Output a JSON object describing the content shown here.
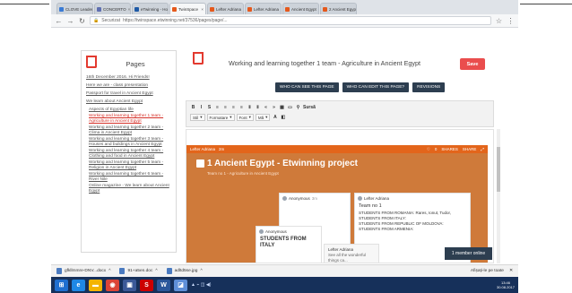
{
  "browser": {
    "tabs": [
      {
        "label": "CLOVE Leader",
        "color": "#3a7bd5"
      },
      {
        "label": "CONCERTO",
        "color": "#5f6fb0"
      },
      {
        "label": "eTwinning - Ho",
        "color": "#1f5aa6"
      },
      {
        "label": "TwinSpace",
        "color": "#e5591c"
      },
      {
        "label": "Lefter Adriana",
        "color": "#e5591c"
      },
      {
        "label": "Lefter Adriana",
        "color": "#e5591c"
      },
      {
        "label": "Ancient Egypt",
        "color": "#e5591c"
      },
      {
        "label": "2 Ancient Egypt",
        "color": "#e5591c"
      }
    ],
    "url_prefix": "Securizat",
    "url": "https://twinspace.etwinning.net/37536/pages/page/..."
  },
  "sidebar": {
    "title": "Pages",
    "items": [
      {
        "label": "16th December 2016. Hi Friends!",
        "cls": ""
      },
      {
        "label": "Here we are - class presentation",
        "cls": ""
      },
      {
        "label": "Passport for travel in Ancient Egypt",
        "cls": ""
      },
      {
        "label": "We learn about Ancient Egypt",
        "cls": "gap"
      },
      {
        "label": "Aspects of Egyptian life",
        "cls": "sub"
      },
      {
        "label": "Working and learning together 1 team - Agriculture in Ancient Egypt",
        "cls": "sub cur"
      },
      {
        "label": "Working and learning together 2 team - Clima in Ancient Egypt",
        "cls": "sub"
      },
      {
        "label": "Working and learning together 3 team - Houses and buildings in Ancient Egypt",
        "cls": "sub"
      },
      {
        "label": "Working and learning together 4 team - Clothing and food in Ancient Egypt",
        "cls": "sub"
      },
      {
        "label": "Working and learning together 5 team - Religion in Ancient Egypt",
        "cls": "sub"
      },
      {
        "label": "Working and learning together 6 team - River Nile",
        "cls": "sub"
      },
      {
        "label": "Online magazine - We learn about Ancient Egypt",
        "cls": "sub"
      }
    ]
  },
  "page": {
    "title": "Working and learning together 1 team - Agriculture in Ancient Egypt",
    "save_label": "Save",
    "actions": [
      "WHO CAN SEE THIS PAGE",
      "WHO CAN EDIT THIS PAGE?",
      "REVISIONS"
    ]
  },
  "editor": {
    "row1": [
      "B",
      "I",
      "S",
      "≡",
      "≡",
      "≡",
      "≡",
      "Ⅱ",
      "Ⅱ",
      "«",
      "»",
      "▦",
      "▭",
      "⚲",
      "Sursă"
    ],
    "row2": {
      "style": "Stil",
      "format": "Formatare",
      "font": "Font",
      "size": "Mă"
    }
  },
  "embed": {
    "author": "Lefter Adriana",
    "time": "2m",
    "bar_right": [
      "0",
      "SHARES",
      "SHARE"
    ],
    "title": "1 Ancient Egypt - Etwinning project",
    "subtitle": "Team no 1 - Agriculture in Ancient Egypt",
    "card1_author": "Anonymous",
    "card1_time": "3m",
    "card2_author": "Lefter Adriana",
    "card2_heading": "Team no 1",
    "card2_lines": [
      "STUDENTS FROM ROMANIA: Rares, Ionut, Tudor,",
      "STUDENTS FROM ITALY:",
      "STUDENTS FROM REPUBLIC OF MOLDOVA:",
      "STUDENTS FROM ARMENIA:"
    ],
    "card3_author": "Anonymous",
    "card3_text": "STUDENTS FROM ITALY",
    "card4_author": "Lefter Adriana",
    "card4_text": "See all the wonderful things ca..."
  },
  "online": "1 member online",
  "downloads": [
    {
      "label": "gfkllmmre-DNV...docx"
    },
    {
      "label": "91+a5en.doc"
    },
    {
      "label": "adltd5se.jpg"
    }
  ],
  "shelf_right": "Afișați-le pe toate",
  "clock": {
    "time": "13:46",
    "date": "30.08.2017"
  }
}
